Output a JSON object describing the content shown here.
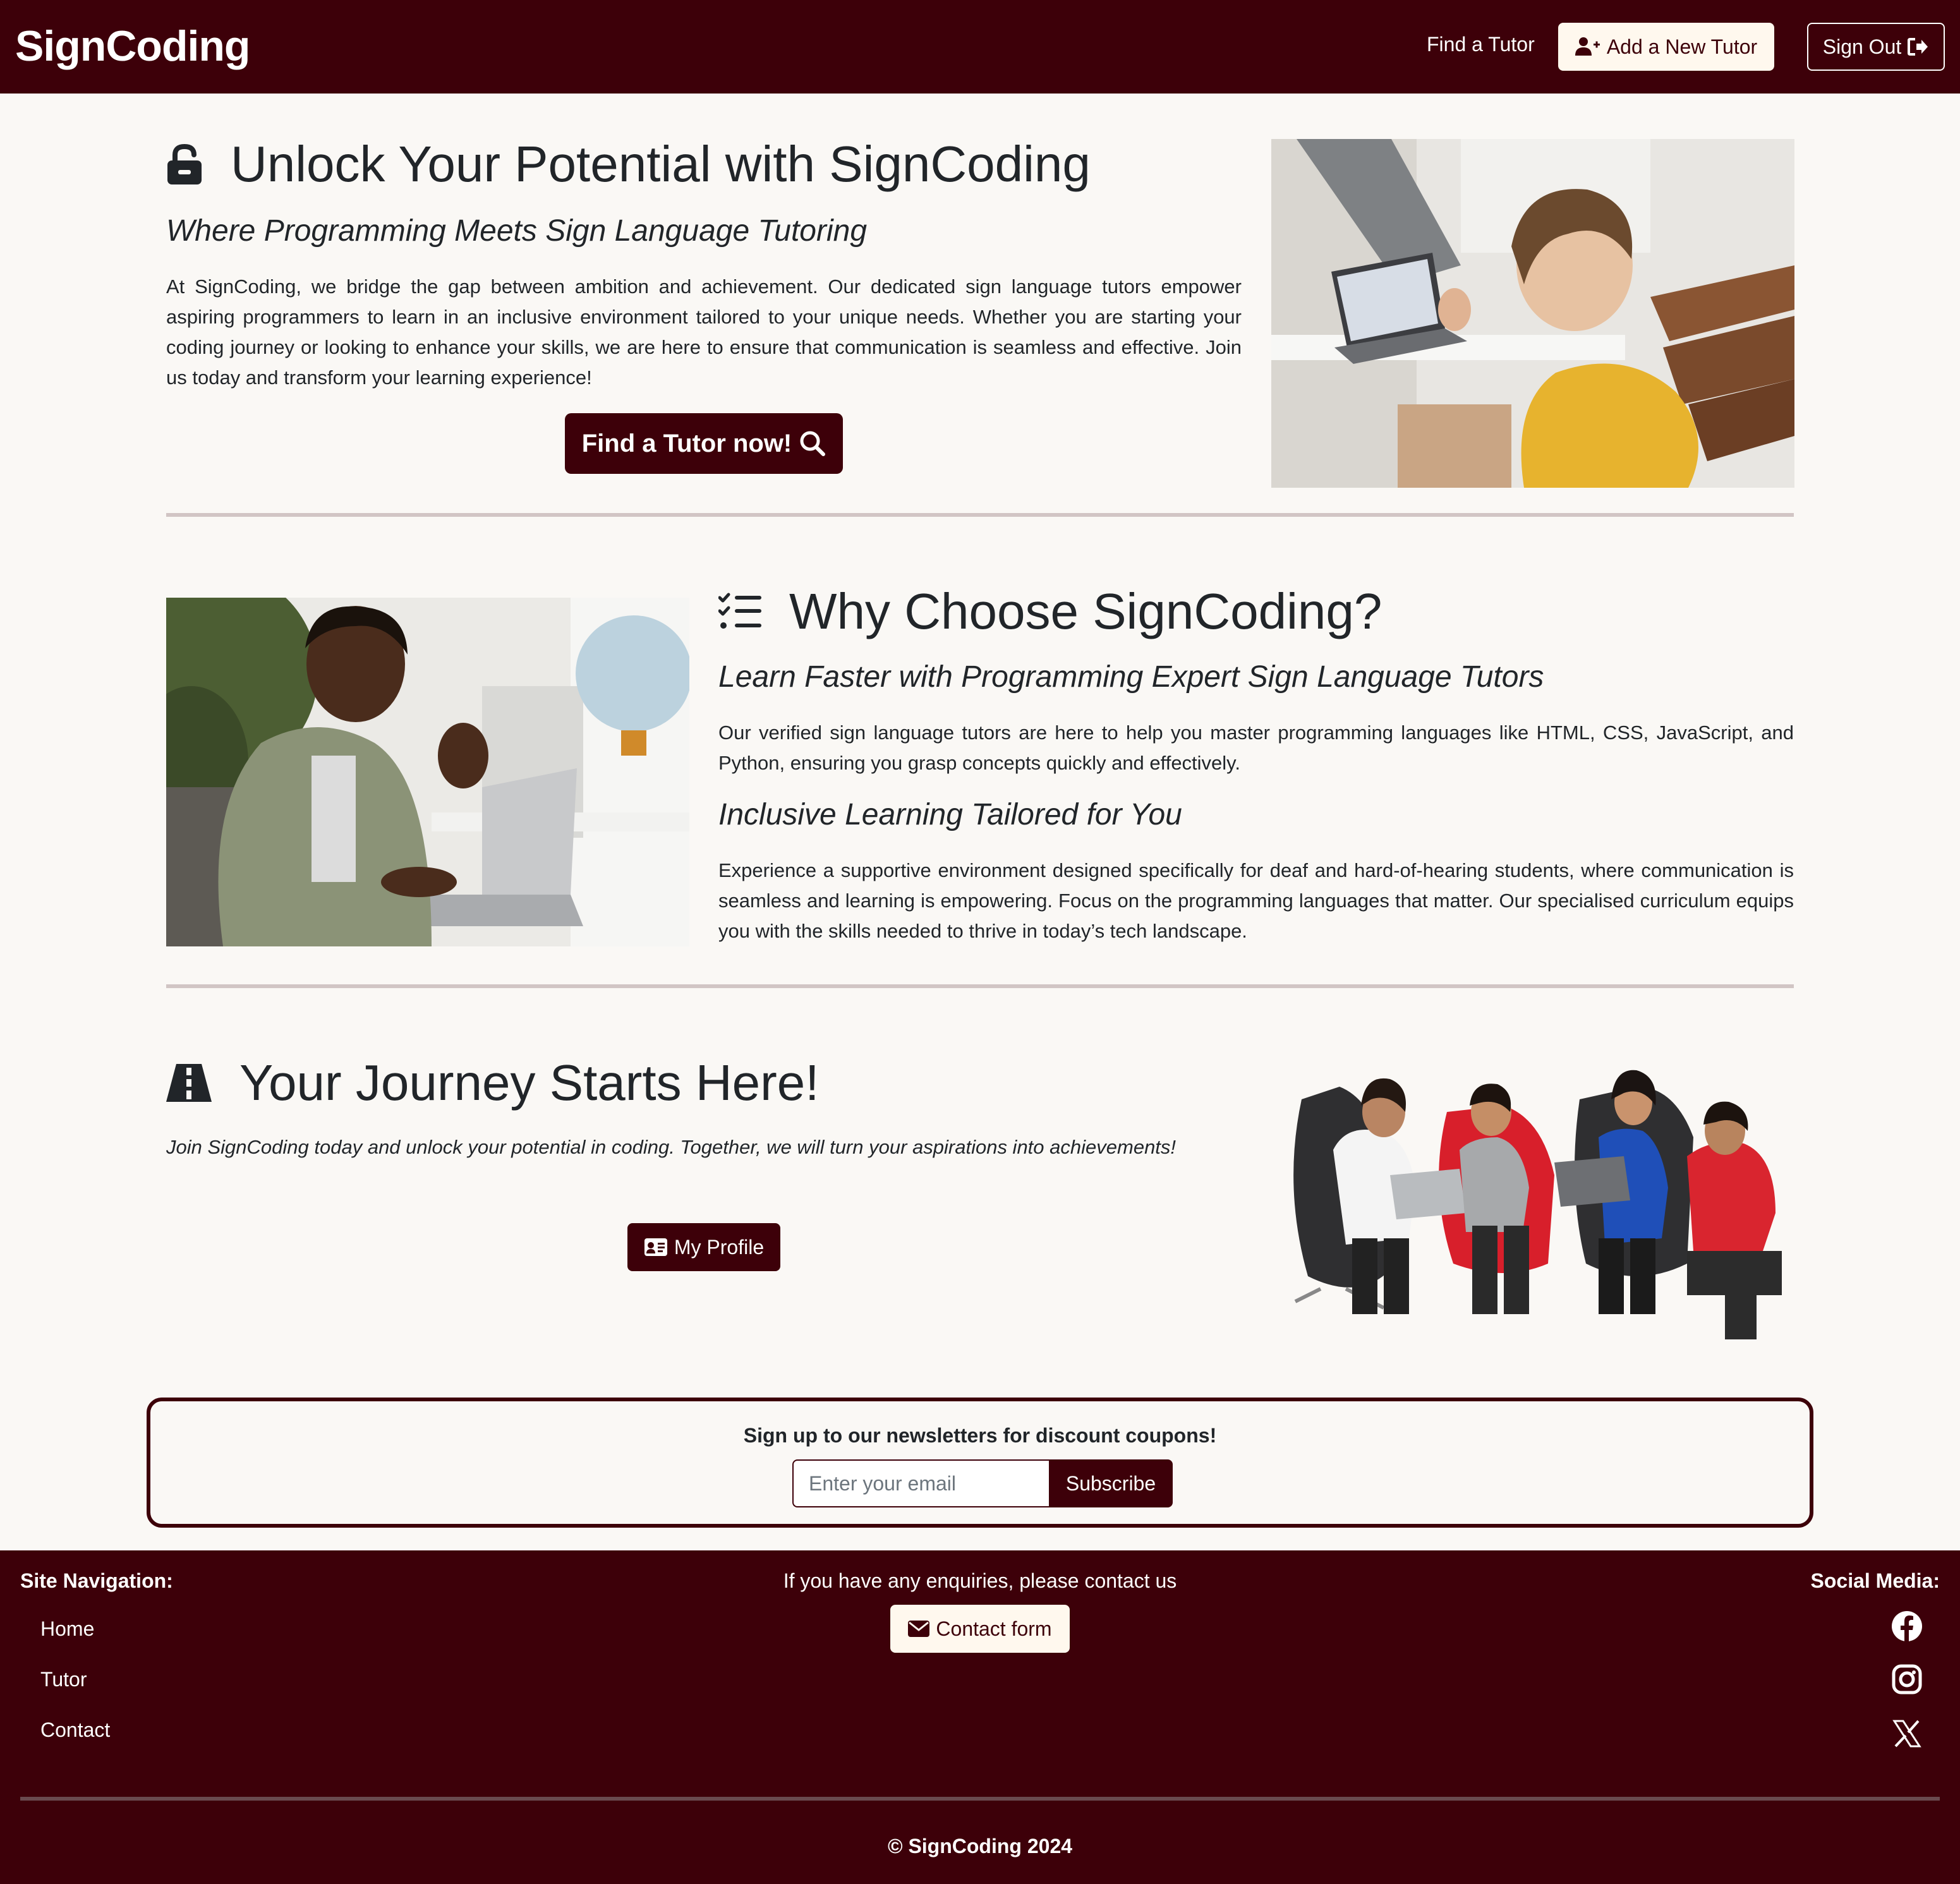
{
  "navbar": {
    "brand": "SignCoding",
    "find_tutor": "Find a Tutor",
    "add_tutor": "Add a New Tutor",
    "sign_out": "Sign Out"
  },
  "hero": {
    "title": "Unlock Your Potential with SignCoding",
    "subtitle": "Where Programming Meets Sign Language Tutoring",
    "body": "At SignCoding, we bridge the gap between ambition and achievement. Our dedicated sign language tutors empower aspiring programmers to learn in an inclusive environment tailored to your unique needs. Whether you are starting your coding journey or looking to enhance your skills, we are here to ensure that communication is seamless and effective. Join us today and transform your learning experience!",
    "cta": "Find a Tutor now!"
  },
  "why": {
    "title": "Why Choose SignCoding?",
    "subtitle1": "Learn Faster with Programming Expert Sign Language Tutors",
    "body1": "Our verified sign language tutors are here to help you master programming languages like HTML, CSS, JavaScript, and Python, ensuring you grasp concepts quickly and effectively.",
    "subtitle2": "Inclusive Learning Tailored for You",
    "body2": "Experience a supportive environment designed specifically for deaf and hard-of-hearing students, where communication is seamless and learning is empowering. Focus on the programming languages that matter. Our specialised curriculum equips you with the skills needed to thrive in today’s tech landscape."
  },
  "journey": {
    "title": "Your Journey Starts Here!",
    "body": "Join SignCoding today and unlock your potential in coding. Together, we will turn your aspirations into achievements!",
    "profile_button": "My Profile"
  },
  "newsletter": {
    "title": "Sign up to our newsletters for discount coupons!",
    "placeholder": "Enter your email",
    "button": "Subscribe"
  },
  "footer": {
    "nav_heading": "Site Navigation:",
    "nav_links": [
      "Home",
      "Tutor",
      "Contact"
    ],
    "contact_text": "If you have any enquiries, please contact us",
    "contact_button": "Contact form",
    "social_heading": "Social Media:",
    "social_icons": [
      "facebook-icon",
      "instagram-icon",
      "x-icon"
    ],
    "copyright": "© SignCoding 2024"
  },
  "colors": {
    "brand": "#3d0009",
    "cream": "#fff8ee",
    "background": "#faf8f5",
    "divider": "#d1c5c4"
  }
}
